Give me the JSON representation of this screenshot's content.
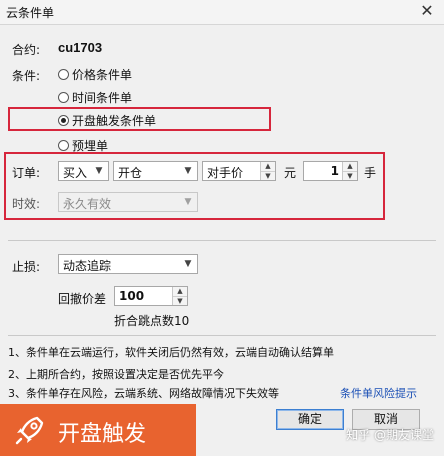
{
  "window": {
    "title": "云条件单"
  },
  "contract": {
    "label": "合约:",
    "value": "cu1703"
  },
  "condition": {
    "label": "条件:",
    "options": [
      {
        "label": "价格条件单",
        "selected": false
      },
      {
        "label": "时间条件单",
        "selected": false
      },
      {
        "label": "开盘触发条件单",
        "selected": true
      },
      {
        "label": "预埋单",
        "selected": false
      }
    ]
  },
  "order": {
    "label": "订单:",
    "direction": "买入",
    "offset": "开仓",
    "price_type": "对手价",
    "price_unit": "元",
    "quantity": "1",
    "quantity_unit": "手"
  },
  "validity": {
    "label": "时效:",
    "value": "永久有效"
  },
  "stop_loss": {
    "label": "止损:",
    "value": "动态追踪",
    "pullback_label": "回撤价差",
    "pullback_value": "100",
    "note": "折合跳点数10"
  },
  "notes": [
    "1、条件单在云端运行，软件关闭后仍然有效，云端自动确认结算单",
    "2、上期所合约，按照设置决定是否优先平今",
    "3、条件单存在风险，云端系统、网络故障情况下失效等"
  ],
  "risk_link": "条件单风险提示",
  "buttons": {
    "ok": "确定",
    "cancel": "取消"
  },
  "banner": {
    "text": "开盘触发"
  },
  "watermark": "知乎 @期友课堂",
  "colors": {
    "highlight": "#d6263c",
    "banner": "#e8632f",
    "link": "#1a4fb5"
  }
}
